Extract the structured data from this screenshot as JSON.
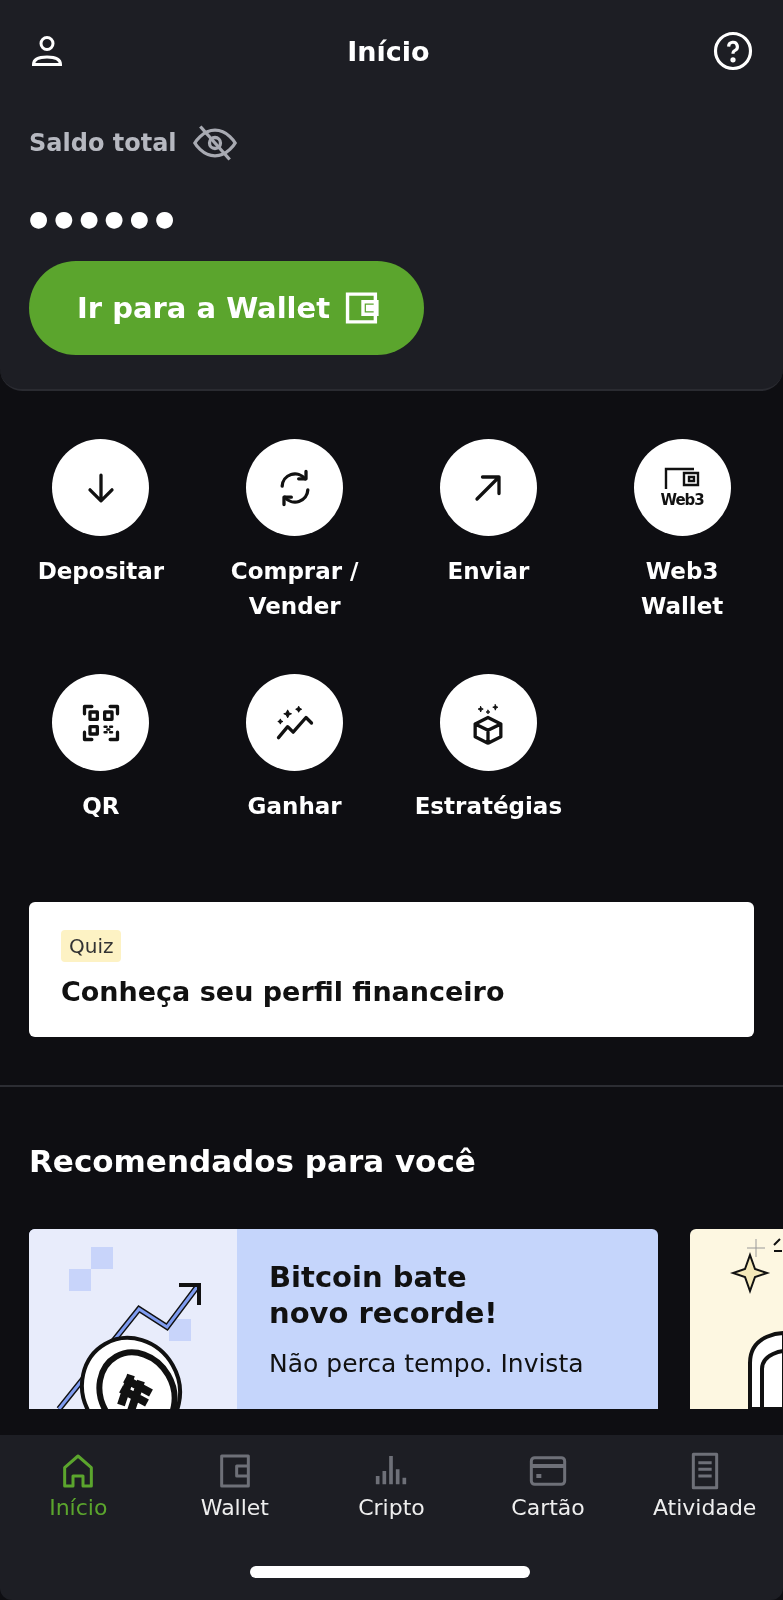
{
  "header": {
    "title": "Início"
  },
  "balance": {
    "label": "Saldo total",
    "hidden_value": "●●●●●●",
    "button": "Ir para a Wallet"
  },
  "actions": [
    {
      "label": "Depositar",
      "kind": "deposit"
    },
    {
      "label": "Comprar / Vender",
      "kind": "swap"
    },
    {
      "label": "Enviar",
      "kind": "send"
    },
    {
      "label": "Web3 Wallet",
      "kind": "web3",
      "icon_text": "Web3"
    },
    {
      "label": "QR",
      "kind": "qr"
    },
    {
      "label": "Ganhar",
      "kind": "earn"
    },
    {
      "label": "Estratégias",
      "kind": "strategies"
    }
  ],
  "quiz": {
    "tag": "Quiz",
    "title": "Conheça seu perfil financeiro"
  },
  "recommended": {
    "title": "Recomendados para você",
    "cards": [
      {
        "kind": "bitcoin",
        "title": "Bitcoin bate novo recorde!",
        "body": "Não perca tempo. Invista"
      },
      {
        "kind": "partial"
      }
    ]
  },
  "nav": [
    {
      "label": "Início",
      "kind": "home",
      "selected": true
    },
    {
      "label": "Wallet",
      "kind": "wallet",
      "selected": false
    },
    {
      "label": "Cripto",
      "kind": "chart",
      "selected": false
    },
    {
      "label": "Cartão",
      "kind": "card",
      "selected": false
    },
    {
      "label": "Atividade",
      "kind": "activity",
      "selected": false
    }
  ]
}
